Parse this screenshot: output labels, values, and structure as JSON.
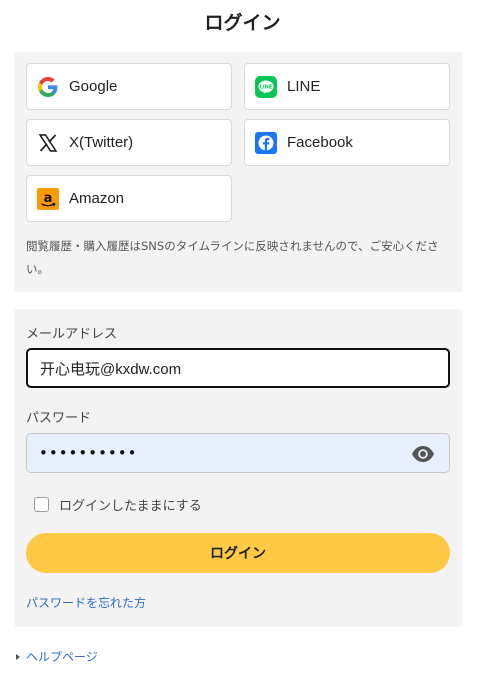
{
  "page": {
    "title": "ログイン"
  },
  "social": {
    "google": {
      "label": "Google",
      "icon": "google-icon"
    },
    "line": {
      "label": "LINE",
      "icon": "line-icon",
      "color": "#06C755"
    },
    "x": {
      "label": "X(Twitter)",
      "icon": "x-twitter-icon"
    },
    "facebook": {
      "label": "Facebook",
      "icon": "facebook-icon",
      "color": "#1877F2"
    },
    "amazon": {
      "label": "Amazon",
      "icon": "amazon-icon",
      "color": "#FF9900"
    },
    "notice": "閲覧履歴・購入履歴はSNSのタイムラインに反映されませんので、ご安心ください。"
  },
  "form": {
    "email_label": "メールアドレス",
    "email_value": "开心电玩@kxdw.com",
    "password_label": "パスワード",
    "password_value": "••••••••••",
    "remember_label": "ログインしたままにする",
    "remember_checked": false,
    "login_button": "ログイン",
    "forgot_link": "パスワードを忘れた方"
  },
  "footer": {
    "help_link": "ヘルプページ"
  },
  "colors": {
    "accent": "#FFC845",
    "link": "#2A6EC7",
    "panel": "#F3F3F3",
    "password_bg": "#E8F0FE"
  }
}
